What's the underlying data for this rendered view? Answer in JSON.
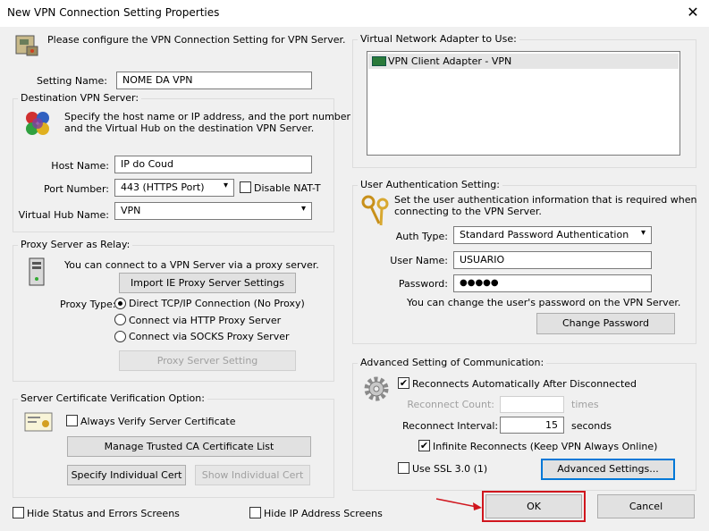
{
  "window": {
    "title": "New VPN Connection Setting Properties",
    "close_glyph": "✕"
  },
  "intro": "Please configure the VPN Connection Setting for VPN Server.",
  "setting_name": {
    "label": "Setting Name:",
    "value": "NOME DA VPN"
  },
  "destination": {
    "group_title": "Destination VPN Server:",
    "desc_line1": "Specify the host name or IP address, and the port number",
    "desc_line2": "and the Virtual Hub on the destination VPN Server.",
    "host_label": "Host Name:",
    "host_value": "IP do Coud",
    "port_label": "Port Number:",
    "port_value": "443 (HTTPS Port)",
    "disable_nat_label": "Disable NAT-T",
    "disable_nat_checked": false,
    "hub_label": "Virtual Hub Name:",
    "hub_value": "VPN"
  },
  "proxy": {
    "group_title": "Proxy Server as Relay:",
    "desc": "You can connect to a VPN Server via a proxy server.",
    "import_button": "Import IE Proxy Server Settings",
    "type_label": "Proxy Type:",
    "options": [
      "Direct TCP/IP Connection (No Proxy)",
      "Connect via HTTP Proxy Server",
      "Connect via SOCKS Proxy Server"
    ],
    "selected_index": 0,
    "setting_button": "Proxy Server Setting"
  },
  "cert": {
    "group_title": "Server Certificate Verification Option:",
    "always_verify_label": "Always Verify Server Certificate",
    "always_verify_checked": false,
    "manage_button": "Manage Trusted CA Certificate List",
    "specify_button": "Specify Individual Cert",
    "show_button": "Show Individual Cert"
  },
  "adapter": {
    "group_title": "Virtual Network Adapter to Use:",
    "items": [
      "VPN Client Adapter - VPN"
    ]
  },
  "auth": {
    "group_title": "User Authentication Setting:",
    "desc_line1": "Set the user authentication information that is required when",
    "desc_line2": "connecting to the VPN Server.",
    "type_label": "Auth Type:",
    "type_value": "Standard Password Authentication",
    "user_label": "User Name:",
    "user_value": "USUARIO",
    "pass_label": "Password:",
    "pass_value": "●●●●●",
    "change_desc": "You can change the user's password on the VPN Server.",
    "change_button": "Change Password"
  },
  "advanced": {
    "group_title": "Advanced Setting of Communication:",
    "reconnect_label": "Reconnects Automatically After Disconnected",
    "reconnect_checked": true,
    "count_label": "Reconnect Count:",
    "count_value": "",
    "count_unit": "times",
    "interval_label": "Reconnect Interval:",
    "interval_value": "15",
    "interval_unit": "seconds",
    "infinite_label": "Infinite Reconnects (Keep VPN Always Online)",
    "infinite_checked": true,
    "ssl3_label": "Use SSL 3.0 (1)",
    "ssl3_checked": false,
    "advanced_button": "Advanced Settings..."
  },
  "footer": {
    "hide_status_label": "Hide Status and Errors Screens",
    "hide_ip_label": "Hide IP Address Screens",
    "ok_button": "OK",
    "cancel_button": "Cancel"
  },
  "colors": {
    "highlight_red": "#d0161e",
    "focus_blue": "#0078d7",
    "check_glyph": "✔"
  }
}
